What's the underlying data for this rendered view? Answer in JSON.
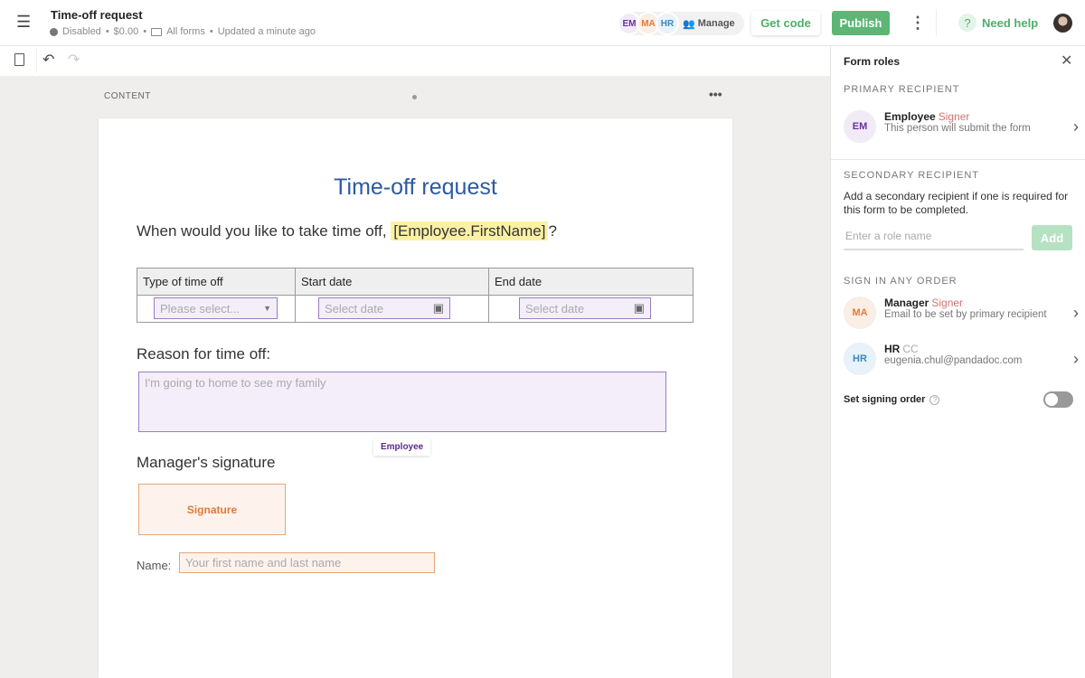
{
  "header": {
    "title": "Time-off request",
    "status": "Disabled",
    "price": "$0.00",
    "folder": "All forms",
    "updated": "Updated a minute ago",
    "roles": [
      {
        "initials": "EM",
        "color": "#6b2fa0",
        "bg": "#f1ebf8"
      },
      {
        "initials": "MA",
        "color": "#e07a3a",
        "bg": "#fbeee5"
      },
      {
        "initials": "HR",
        "color": "#3b86c0",
        "bg": "#e8f2fa"
      }
    ],
    "manage": "Manage",
    "get_code": "Get code",
    "publish": "Publish",
    "help": "Need help"
  },
  "canvas": {
    "section_label": "CONTENT"
  },
  "form": {
    "title": "Time-off request",
    "question": "When would you like to take time off,",
    "variable": "[Employee.FirstName]",
    "question_end": "?",
    "table_headers": [
      "Type of time off",
      "Start date",
      "End date"
    ],
    "select_placeholder": "Please select...",
    "date_placeholder": "Select date",
    "reason_label": "Reason for time off:",
    "reason_placeholder": "I'm going to home to see my family",
    "reason_role": "Employee",
    "signature_heading": "Manager's signature",
    "signature_label": "Signature",
    "name_label": "Name:",
    "name_placeholder": "Your first name and last name"
  },
  "panel": {
    "title": "Form roles",
    "primary_heading": "PRIMARY RECIPIENT",
    "primary": {
      "initials": "EM",
      "name": "Employee",
      "type": "Signer",
      "desc": "This person will submit the form"
    },
    "secondary_heading": "SECONDARY RECIPIENT",
    "secondary_desc": "Add a secondary recipient if one is required for this form to be completed.",
    "role_placeholder": "Enter a role name",
    "add": "Add",
    "order_heading": "SIGN IN ANY ORDER",
    "others": [
      {
        "initials": "MA",
        "name": "Manager",
        "type": "Signer",
        "desc": "Email to be set by primary recipient"
      },
      {
        "initials": "HR",
        "name": "HR",
        "type": "CC",
        "desc": "eugenia.chul@pandadoc.com"
      }
    ],
    "signing_order": "Set signing order",
    "signing_order_enabled": false
  }
}
